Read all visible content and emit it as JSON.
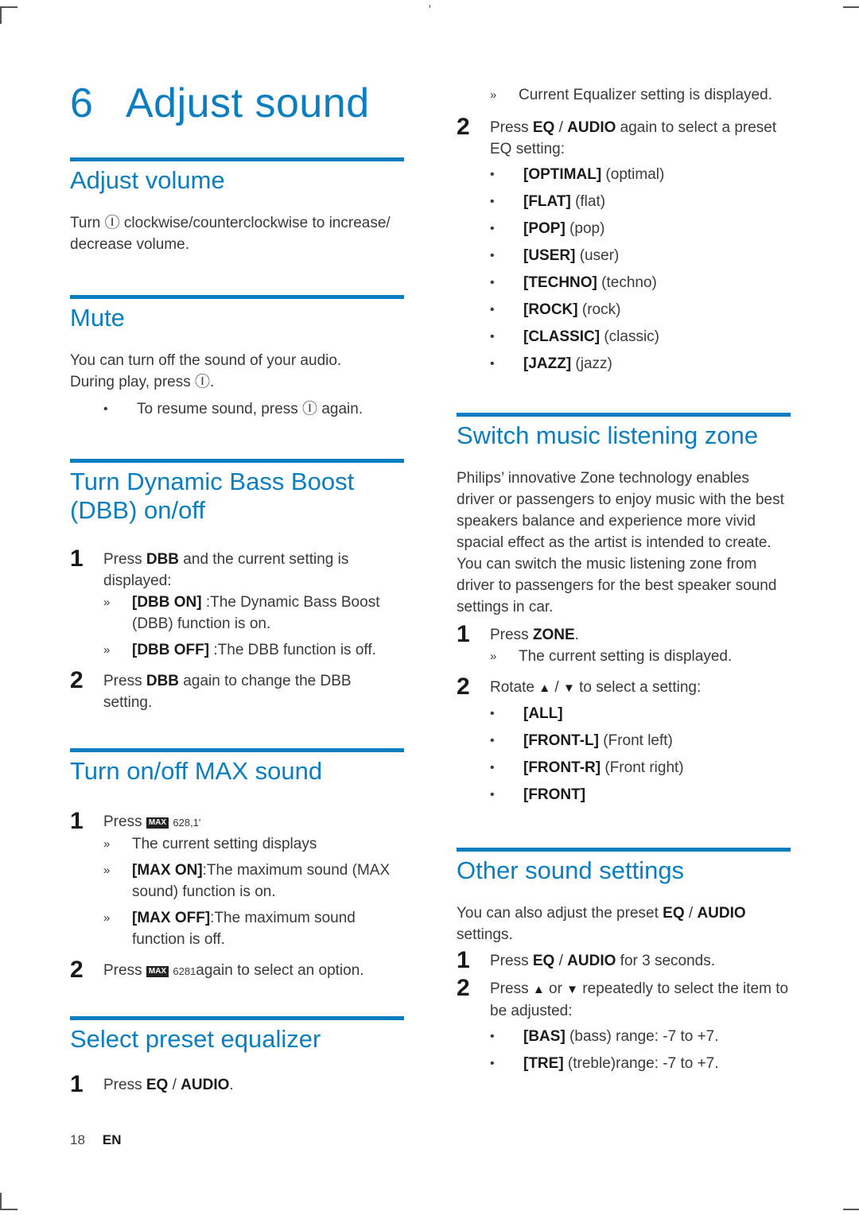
{
  "chapter": {
    "number": "6",
    "title": "Adjust sound"
  },
  "footer": {
    "page": "18",
    "lang": "EN"
  },
  "accent_color": "#0b7ec1",
  "left": {
    "adjust_volume": {
      "title": "Adjust volume",
      "text_pre": "Turn ",
      "icon": "volume-knob-icon",
      "text_post": " clockwise/counterclockwise to increase/ decrease volume."
    },
    "mute": {
      "title": "Mute",
      "line1": "You can turn off the sound of your audio.",
      "line2_pre": "During play, press ",
      "line2_post": ".",
      "bullet_pre": "To resume sound, press ",
      "bullet_post": " again."
    },
    "dbb": {
      "title": "Turn Dynamic Bass Boost (DBB) on/off",
      "step1": {
        "num": "1",
        "pre": "Press ",
        "key": "DBB",
        "post": " and the current setting is displayed:"
      },
      "step1_subs": [
        {
          "key": "[DBB ON]",
          "text": " :The Dynamic Bass Boost (DBB) function is on."
        },
        {
          "key": "[DBB OFF]",
          "text": " :The DBB function is off."
        }
      ],
      "step2": {
        "num": "2",
        "pre": "Press ",
        "key": "DBB",
        "post": " again to change the DBB setting."
      }
    },
    "max": {
      "title": "Turn on/off MAX sound",
      "step1": {
        "num": "1",
        "pre": "Press ",
        "badge": "MAX",
        "garble": "628,1'"
      },
      "step1_subs": [
        {
          "key": "",
          "text": "The current setting displays"
        },
        {
          "key": "[MAX ON]",
          "text": ":The maximum sound (MAX sound) function is on."
        },
        {
          "key": "[MAX OFF]",
          "text": ":The maximum sound function is off."
        }
      ],
      "step2": {
        "num": "2",
        "pre": "Press ",
        "badge": "MAX",
        "garble": "6281",
        "post": "again to select an option."
      }
    },
    "eq": {
      "title": "Select preset equalizer",
      "step1": {
        "num": "1",
        "pre": "Press ",
        "key": "EQ",
        "sep": " / ",
        "key2": "AUDIO",
        "post": "."
      }
    }
  },
  "right": {
    "eq_cont": {
      "sub": "Current Equalizer setting is displayed.",
      "step2": {
        "num": "2",
        "pre": "Press ",
        "key": "EQ",
        "sep": " / ",
        "key2": "AUDIO",
        "post": " again to select a preset EQ setting:"
      },
      "options": [
        {
          "key": "[OPTIMAL]",
          "desc": " (optimal)"
        },
        {
          "key": "[FLAT]",
          "desc": " (flat)"
        },
        {
          "key": "[POP]",
          "desc": " (pop)"
        },
        {
          "key": "[USER]",
          "desc": " (user)"
        },
        {
          "key": "[TECHNO]",
          "desc": " (techno)"
        },
        {
          "key": "[ROCK]",
          "desc": " (rock)"
        },
        {
          "key": "[CLASSIC]",
          "desc": " (classic)"
        },
        {
          "key": "[JAZZ]",
          "desc": " (jazz)"
        }
      ]
    },
    "zone": {
      "title": "Switch music listening zone",
      "intro": "Philips’ innovative Zone technology enables driver or passengers to enjoy music with the best speakers balance and experience more vivid spacial effect as the artist is intended to create. You can switch the music listening zone from driver to passengers for the best speaker sound settings in car.",
      "step1": {
        "num": "1",
        "pre": "Press ",
        "key": "ZONE",
        "post": "."
      },
      "step1_sub": "The current setting is displayed.",
      "step2": {
        "num": "2",
        "pre": "Rotate ",
        "up": "▲",
        "sep": " / ",
        "down": "▼",
        "post": " to select a setting:"
      },
      "options": [
        {
          "key": "[ALL]",
          "desc": ""
        },
        {
          "key": "[FRONT-L]",
          "desc": " (Front left)"
        },
        {
          "key": "[FRONT-R]",
          "desc": " (Front right)"
        },
        {
          "key": "[FRONT]",
          "desc": ""
        }
      ]
    },
    "other": {
      "title": "Other sound settings",
      "intro_pre": "You can also adjust the preset ",
      "intro_key": "EQ",
      "intro_sep": " / ",
      "intro_key2": "AUDIO",
      "intro_post": " settings.",
      "step1": {
        "num": "1",
        "pre": "Press ",
        "key": "EQ",
        "sep": " / ",
        "key2": "AUDIO",
        "post": " for 3 seconds."
      },
      "step2": {
        "num": "2",
        "pre": "Press ",
        "up": "▲",
        "mid": " or ",
        "down": "▼",
        "post": " repeatedly to select the item to be adjusted:"
      },
      "options": [
        {
          "key": "[BAS]",
          "desc": " (bass) range: -7 to +7."
        },
        {
          "key": "[TRE]",
          "desc": " (treble)range: -7 to +7."
        }
      ]
    }
  }
}
